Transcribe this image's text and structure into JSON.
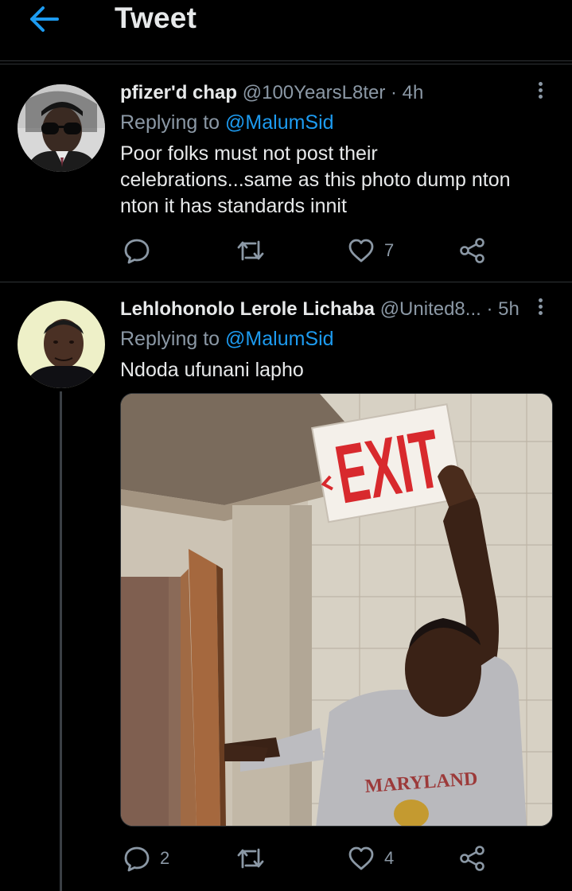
{
  "header": {
    "title": "Tweet",
    "back_icon": "arrow-left-icon",
    "accent_color": "#1d9bf0"
  },
  "tweets": [
    {
      "display_name": "pfizer'd chap",
      "handle": "@100YearsL8ter",
      "time": "· 4h",
      "replying_prefix": "Replying to",
      "replying_to": "@MalumSid",
      "text": "Poor folks must not post their celebrations...same as this photo dump nton nton it has standards innit",
      "replies": "",
      "retweets": "",
      "likes": "7"
    },
    {
      "display_name": "Lehlohonolo Lerole Lichaba",
      "handle": "@United8...",
      "time": "· 5h",
      "replying_prefix": "Replying to",
      "replying_to": "@MalumSid",
      "text": "Ndoda ufunani lapho",
      "media": {
        "sign_text": "EXIT",
        "shirt_text": "MARYLAND"
      },
      "replies": "2",
      "retweets": "",
      "likes": "4"
    }
  ],
  "icons": {
    "reply": "reply-bubble-icon",
    "retweet": "retweet-icon",
    "like": "heart-icon",
    "share": "share-icon",
    "more": "more-vertical-icon"
  }
}
